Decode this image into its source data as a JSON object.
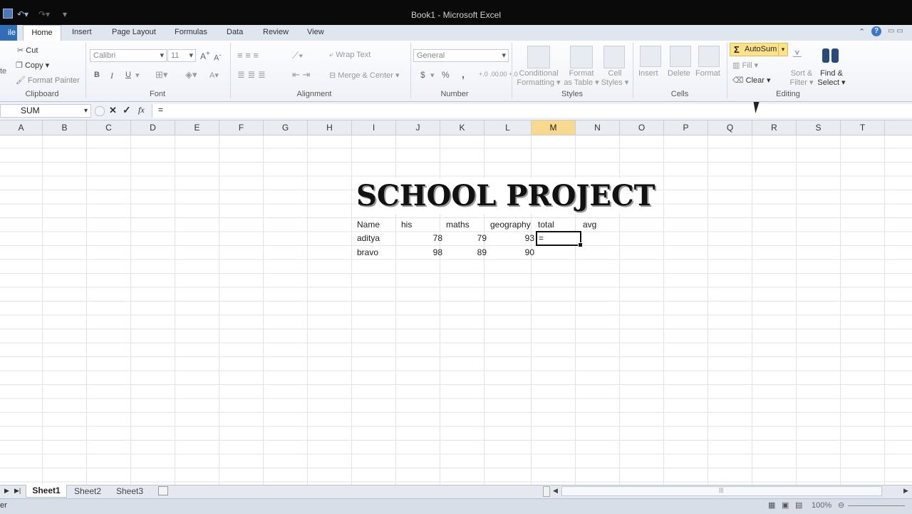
{
  "window": {
    "title": "Book1 - Microsoft Excel"
  },
  "tabs": {
    "file": "ile",
    "home": "Home",
    "insert": "Insert",
    "page_layout": "Page Layout",
    "formulas": "Formulas",
    "data": "Data",
    "review": "Review",
    "view": "View"
  },
  "ribbon": {
    "clipboard": {
      "cut": "Cut",
      "copy": "Copy",
      "format_painter": "Format Painter",
      "label": "Clipboard",
      "paste_stub": "te"
    },
    "font": {
      "name": "Calibri",
      "size": "11",
      "bold": "B",
      "italic": "I",
      "underline": "U",
      "label": "Font"
    },
    "alignment": {
      "wrap_text": "Wrap Text",
      "merge_center": "Merge & Center",
      "label": "Alignment"
    },
    "number": {
      "format": "General",
      "currency": "$",
      "percent": "%",
      "comma": ",",
      "inc_dec": "+.0 .00",
      "dec_dec": ".00 +.0",
      "label": "Number"
    },
    "styles": {
      "conditional": "Conditional",
      "formatting": "Formatting",
      "format": "Format",
      "as_table": "as Table",
      "cell": "Cell",
      "styles_txt": "Styles",
      "label": "Styles"
    },
    "cells": {
      "insert": "Insert",
      "delete": "Delete",
      "format": "Format",
      "label": "Cells"
    },
    "editing": {
      "autosum": "AutoSum",
      "fill": "Fill",
      "clear": "Clear",
      "sort": "Sort &",
      "filter": "Filter",
      "find": "Find &",
      "select": "Select",
      "label": "Editing"
    }
  },
  "formula_bar": {
    "name_box": "SUM",
    "cancel": "✕",
    "enter": "✓",
    "fx": "fx",
    "content": "="
  },
  "columns": [
    "A",
    "B",
    "C",
    "D",
    "E",
    "F",
    "G",
    "H",
    "I",
    "J",
    "K",
    "L",
    "M",
    "N",
    "O",
    "P",
    "Q",
    "R",
    "S",
    "T"
  ],
  "sheet": {
    "title": "SCHOOL PROJECT",
    "headers": [
      "Name",
      "his",
      "maths",
      "geography",
      "total",
      "avg"
    ],
    "rows": [
      {
        "name": "aditya",
        "his": "78",
        "maths": "79",
        "geography": "93",
        "total": "="
      },
      {
        "name": "bravo",
        "his": "98",
        "maths": "89",
        "geography": "90",
        "total": ""
      }
    ]
  },
  "sheet_tabs": [
    "Sheet1",
    "Sheet2",
    "Sheet3"
  ],
  "status": {
    "mode": "er",
    "zoom": "100%"
  }
}
